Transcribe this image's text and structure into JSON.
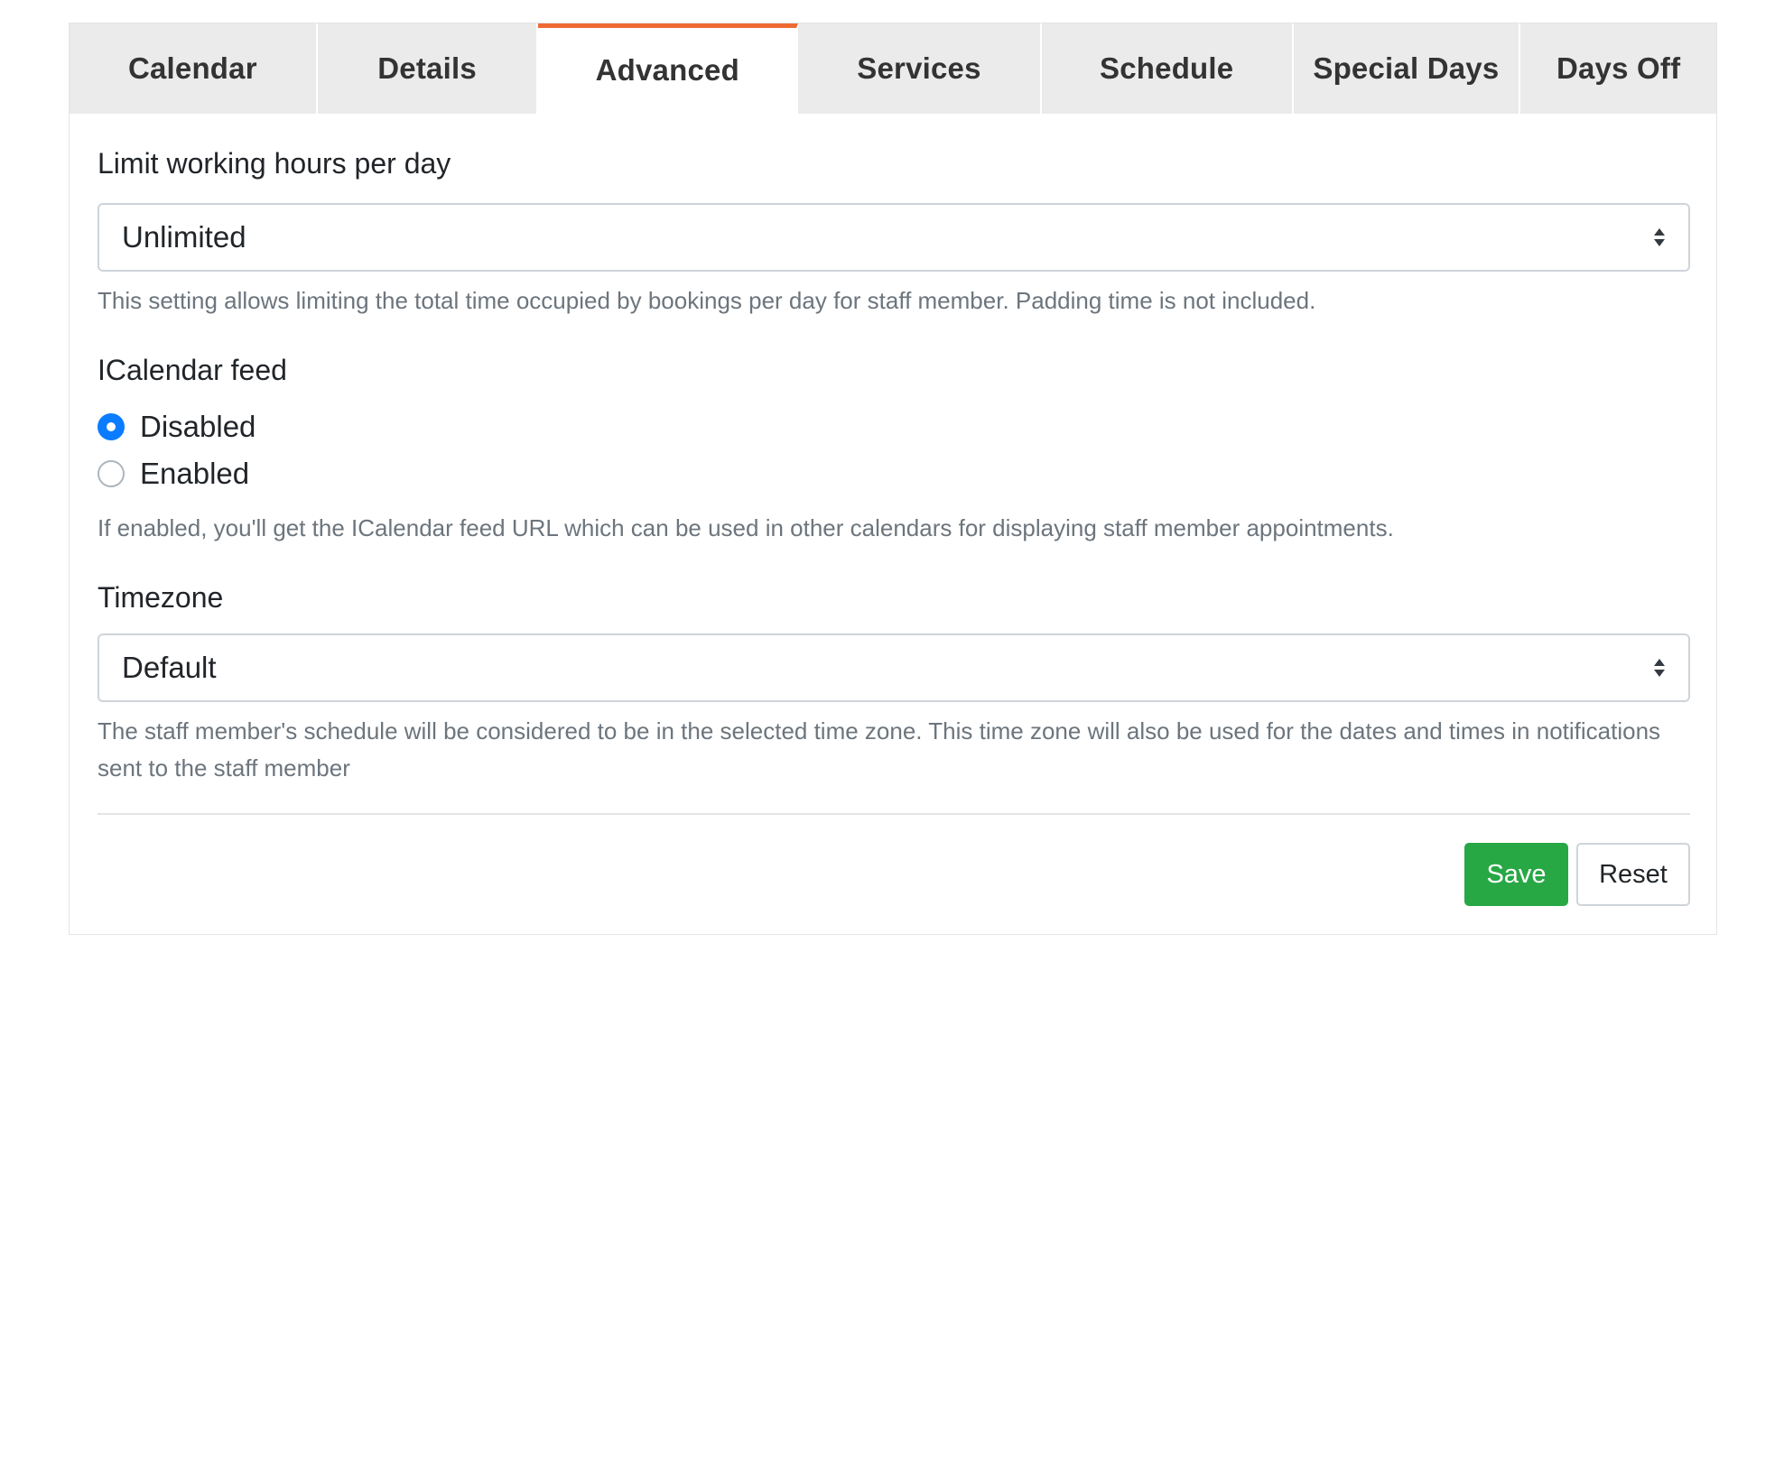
{
  "tabs": [
    {
      "label": "Calendar"
    },
    {
      "label": "Details"
    },
    {
      "label": "Advanced"
    },
    {
      "label": "Services"
    },
    {
      "label": "Schedule"
    },
    {
      "label": "Special Days"
    },
    {
      "label": "Days Off"
    }
  ],
  "active_tab": "Advanced",
  "working_hours": {
    "label": "Limit working hours per day",
    "value": "Unlimited",
    "help": "This setting allows limiting the total time occupied by bookings per day for staff member. Padding time is not included."
  },
  "icalendar": {
    "label": "ICalendar feed",
    "options": [
      {
        "label": "Disabled",
        "checked": true
      },
      {
        "label": "Enabled",
        "checked": false
      }
    ],
    "help": "If enabled, you'll get the ICalendar feed URL which can be used in other calendars for displaying staff member appointments."
  },
  "timezone": {
    "label": "Timezone",
    "value": "Default",
    "help": "The staff member's schedule will be considered to be in the selected time zone. This time zone will also be used for the dates and times in notifications sent to the staff member"
  },
  "actions": {
    "save_label": "Save",
    "reset_label": "Reset"
  },
  "colors": {
    "active_tab_accent": "#ef6a33",
    "save_button": "#28a745",
    "radio_checked": "#0b7cff"
  }
}
